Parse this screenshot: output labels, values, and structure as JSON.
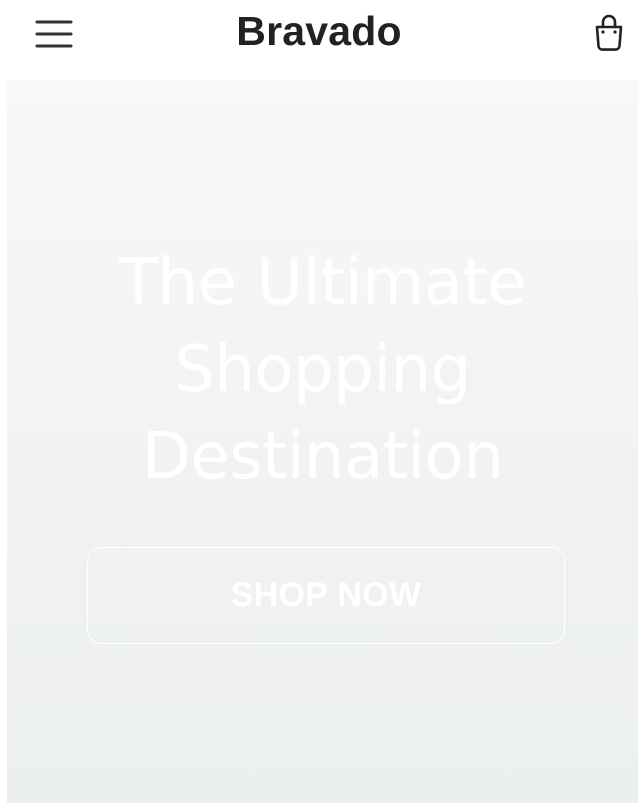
{
  "header": {
    "brand": "Bravado",
    "menu_icon": "hamburger-menu-icon",
    "cart_icon": "shopping-bag-icon"
  },
  "hero": {
    "title_lines": [
      "The Ultimate",
      "Shopping",
      "Destination"
    ],
    "cta_label": "SHOP NOW"
  },
  "colors": {
    "brand_text": "#222222",
    "hero_bg_top": "#f7f8f9",
    "hero_bg_bottom": "#eceff0",
    "hero_text": "#ffffff"
  }
}
